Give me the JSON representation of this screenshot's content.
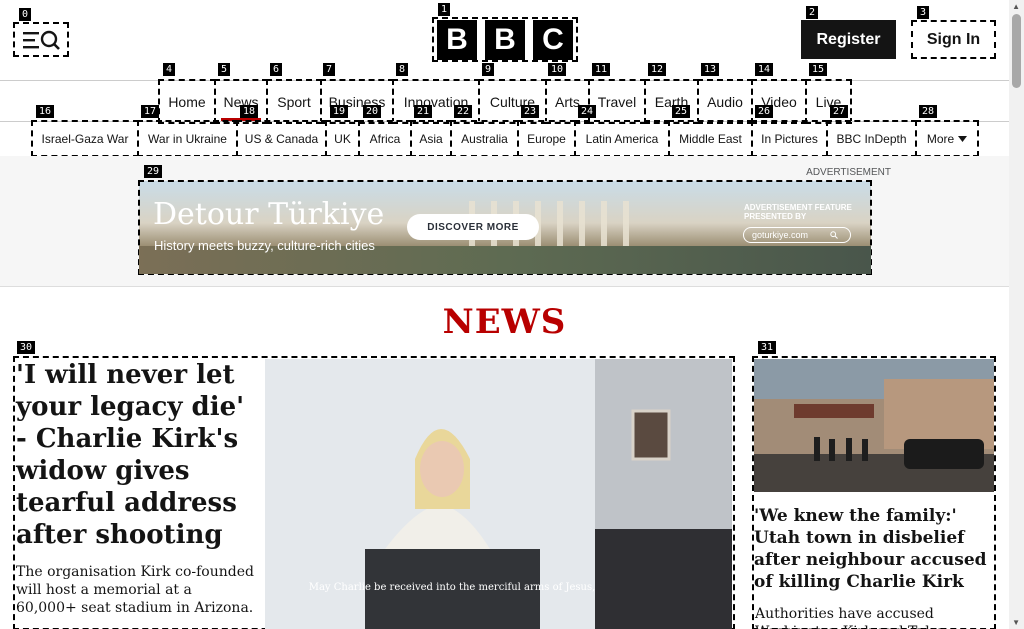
{
  "header": {
    "logo_letters": [
      "B",
      "B",
      "C"
    ],
    "register_label": "Register",
    "signin_label": "Sign In",
    "menu_icon": "menu-search-icon"
  },
  "nav": {
    "items": [
      "Home",
      "News",
      "Sport",
      "Business",
      "Innovation",
      "Culture",
      "Arts",
      "Travel",
      "Earth",
      "Audio",
      "Video",
      "Live"
    ],
    "active": "News"
  },
  "subnav": {
    "items": [
      "Israel-Gaza War",
      "War in Ukraine",
      "US & Canada",
      "UK",
      "Africa",
      "Asia",
      "Australia",
      "Europe",
      "Latin America",
      "Middle East",
      "In Pictures",
      "BBC InDepth",
      "More"
    ]
  },
  "ad": {
    "label": "ADVERTISEMENT",
    "title": "Detour Türkiye",
    "subtitle": "History meets buzzy, culture-rich cities",
    "cta": "DISCOVER MORE",
    "feature": "ADVERTISEMENT FEATURE PRESENTED BY",
    "site": "goturkiye.com"
  },
  "section": {
    "heading": "NEWS"
  },
  "lead_story": {
    "title": "'I will never let your legacy die' - Charlie Kirk's widow gives tearful address after shooting",
    "summary": "The organisation Kirk co-founded will host a memorial at a 60,000+ seat stadium in Arizona.",
    "podium_text": "May Charlie be received into the merciful arms of Jesus,"
  },
  "side_story": {
    "title": "'We knew the family:' Utah town in disbelief after neighbour accused of killing Charlie Kirk",
    "summary": "Authorities have accused Washington Kirk and Tyler"
  },
  "som_labels": [
    "0",
    "1",
    "2",
    "3",
    "4",
    "5",
    "6",
    "7",
    "8",
    "9",
    "10",
    "11",
    "12",
    "13",
    "14",
    "15",
    "16",
    "17",
    "18",
    "19",
    "20",
    "21",
    "22",
    "23",
    "24",
    "25",
    "26",
    "27",
    "28",
    "29",
    "30",
    "31"
  ],
  "colors": {
    "brand_red": "#b80000",
    "text": "#141414",
    "register_bg": "#141414"
  }
}
